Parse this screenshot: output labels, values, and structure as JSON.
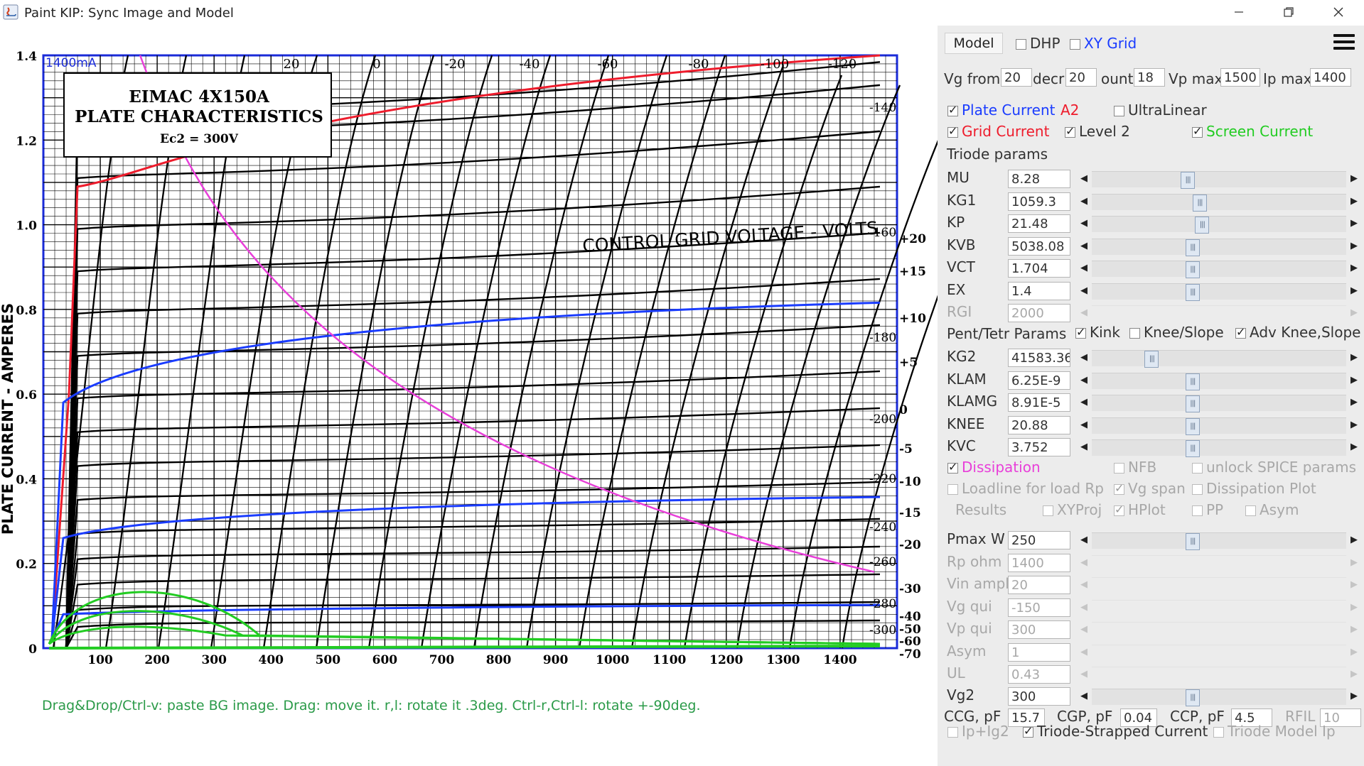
{
  "window": {
    "title": "Paint KIP: Sync Image and Model"
  },
  "colors": {
    "plate_current": "#1a3cff",
    "grid_current": "#ee1c2c",
    "screen_current": "#22cc22",
    "dissipation": "#e83fd9",
    "status_text": "#2a9a48",
    "a2": "#ee1c2c"
  },
  "image": {
    "title1": "EIMAC 4X150A",
    "title2": "PLATE CHARACTERISTICS",
    "title3": "Ec2 = 300V",
    "corner": "1400mA",
    "ylabel": "PLATE CURRENT - AMPERES",
    "curve_label": "CONTROL GRID VOLTAGE - VOLTS",
    "top_labels": [
      "20",
      "0",
      "-20",
      "-40",
      "-60",
      "-80",
      "-100",
      "-120"
    ],
    "x_ticks": [
      "100",
      "200",
      "300",
      "400",
      "500",
      "600",
      "700",
      "800",
      "900",
      "1000",
      "1100",
      "1200",
      "1300",
      "1400"
    ],
    "y_ticks": [
      "0",
      "0.2",
      "0.4",
      "0.6",
      "0.8",
      "1.0",
      "1.2",
      "1.4"
    ],
    "right_ticks": [
      "+20",
      "+15",
      "+10",
      "+5",
      "0",
      "-5",
      "-10",
      "-15",
      "-20",
      "-30",
      "-40",
      "-50",
      "-60",
      "-70"
    ],
    "right_inner": [
      "-140",
      "-160",
      "-180",
      "-200",
      "-220",
      "-240",
      "-260",
      "-280",
      "-300"
    ]
  },
  "status_text": "Drag&Drop/Ctrl-v: paste BG image. Drag: move it. r,l: rotate it .3deg. Ctrl-r,Ctrl-l: rotate +-90deg.",
  "panel": {
    "model_button": "Model",
    "dhp": {
      "label": "DHP",
      "checked": false
    },
    "xy_grid": {
      "label": "XY Grid",
      "checked": false
    },
    "vg_from": {
      "label": "Vg from",
      "value": "20"
    },
    "decr": {
      "label": "decr",
      "value": "20"
    },
    "count": {
      "label": "ount",
      "value": "18"
    },
    "vp_max": {
      "label": "Vp max",
      "value": "1500"
    },
    "ip_max": {
      "label": "Ip max",
      "value": "1400"
    },
    "plate_current": {
      "label": "Plate Current",
      "checked": true
    },
    "a2": "A2",
    "ultralinear": {
      "label": "UltraLinear",
      "checked": false
    },
    "grid_current": {
      "label": "Grid Current",
      "checked": true
    },
    "level2": {
      "label": "Level 2",
      "checked": true
    },
    "screen_current": {
      "label": "Screen Current",
      "checked": true
    },
    "triode_params": "Triode params",
    "pent_params": "Pent/Tetr Params",
    "kink": {
      "label": "Kink",
      "checked": true
    },
    "knee_slope": {
      "label": "Knee/Slope",
      "checked": false
    },
    "adv_knee": {
      "label": "Adv Knee,Slope",
      "checked": true
    },
    "params": [
      {
        "name": "MU",
        "value": "8.28",
        "level": 0.37,
        "disabled": false
      },
      {
        "name": "KG1",
        "value": "1059.3",
        "level": 0.42,
        "disabled": false
      },
      {
        "name": "KP",
        "value": "21.48",
        "level": 0.43,
        "disabled": false
      },
      {
        "name": "KVB",
        "value": "5038.08",
        "level": 0.39,
        "disabled": false
      },
      {
        "name": "VCT",
        "value": "1.704",
        "level": 0.39,
        "disabled": false
      },
      {
        "name": "EX",
        "value": "1.4",
        "level": 0.39,
        "disabled": false
      },
      {
        "name": "RGI",
        "value": "2000",
        "level": null,
        "disabled": true
      },
      {
        "name": "KG2",
        "value": "41583.36",
        "level": 0.22,
        "disabled": false
      },
      {
        "name": "KLAM",
        "value": "6.25E-9",
        "level": 0.39,
        "disabled": false
      },
      {
        "name": "KLAMG",
        "value": "8.91E-5",
        "level": 0.39,
        "disabled": false
      },
      {
        "name": "KNEE",
        "value": "20.88",
        "level": 0.39,
        "disabled": false
      },
      {
        "name": "KVC",
        "value": "3.752",
        "level": 0.39,
        "disabled": false
      }
    ],
    "dissipation": {
      "label": "Dissipation",
      "checked": true
    },
    "nfb": {
      "label": "NFB",
      "checked": false
    },
    "unlock_spice": {
      "label": "unlock SPICE params",
      "checked": false
    },
    "loadline": {
      "label": "Loadline for load Rp",
      "checked": false
    },
    "vg_span": {
      "label": "Vg span",
      "checked": true
    },
    "dissipation_plot": {
      "label": "Dissipation Plot",
      "checked": false
    },
    "results": "Results",
    "xyproj": {
      "label": "XYProj",
      "checked": false
    },
    "hplot": {
      "label": "HPlot",
      "checked": true
    },
    "pp": {
      "label": "PP",
      "checked": false
    },
    "asym_cb": {
      "label": "Asym",
      "checked": false
    },
    "load_params": [
      {
        "name": "Pmax W",
        "value": "250",
        "level": 0.39,
        "disabled": false
      },
      {
        "name": "Rp ohm",
        "value": "1400",
        "level": null,
        "disabled": true
      },
      {
        "name": "Vin ampl",
        "value": "20",
        "level": null,
        "disabled": true
      },
      {
        "name": "Vg qui",
        "value": "-150",
        "level": null,
        "disabled": true
      },
      {
        "name": "Vp qui",
        "value": "300",
        "level": null,
        "disabled": true
      },
      {
        "name": "Asym",
        "value": "1",
        "level": null,
        "disabled": true
      },
      {
        "name": "UL",
        "value": "0.43",
        "level": null,
        "disabled": true
      },
      {
        "name": "Vg2",
        "value": "300",
        "level": 0.39,
        "disabled": false
      }
    ],
    "ccg": {
      "label": "CCG, pF",
      "value": "15.7"
    },
    "cgp": {
      "label": "CGP, pF",
      "value": "0.04"
    },
    "ccp": {
      "label": "CCP, pF",
      "value": "4.5"
    },
    "rfil": {
      "label": "RFIL",
      "value": "10"
    },
    "ip_ig2": {
      "label": "Ip+Ig2",
      "checked": false
    },
    "triode_strapped": {
      "label": "Triode-Strapped Current",
      "checked": true
    },
    "triode_model_ip": {
      "label": "Triode Model Ip",
      "checked": false
    }
  }
}
